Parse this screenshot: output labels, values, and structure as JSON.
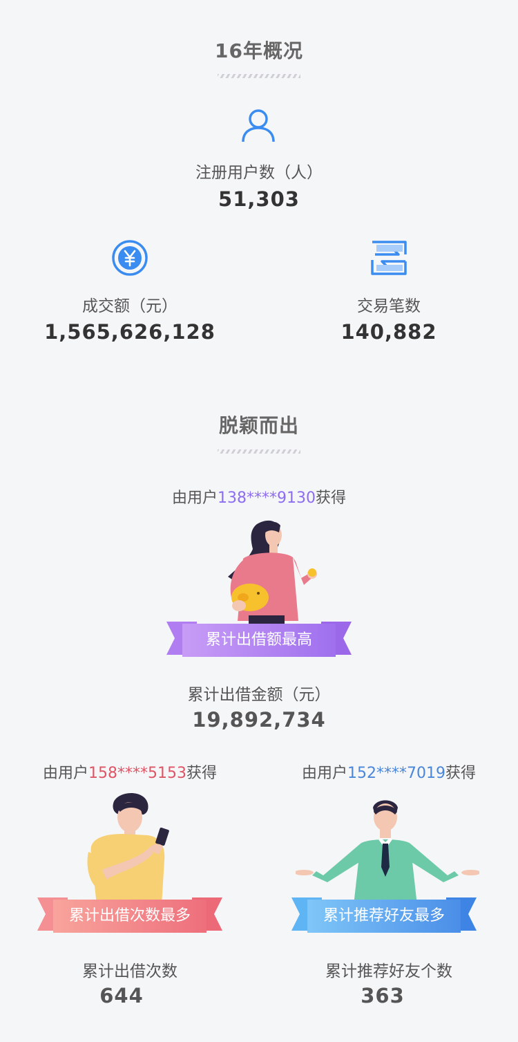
{
  "overview": {
    "title": "16年概况",
    "users": {
      "label": "注册用户数（人）",
      "value": "51,303"
    },
    "volume": {
      "label": "成交额（元）",
      "value": "1,565,626,128"
    },
    "trades": {
      "label": "交易笔数",
      "value": "140,882"
    }
  },
  "standout": {
    "title": "脱颖而出",
    "top_lender": {
      "prefix": "由用户",
      "phone": "138****9130",
      "suffix": "获得",
      "ribbon": "累计出借额最高",
      "stat_label": "累计出借金额（元）",
      "stat_value": "19,892,734",
      "accent": "#8d6cf4"
    },
    "most_lends": {
      "prefix": "由用户",
      "phone": "158****5153",
      "suffix": "获得",
      "ribbon": "累计出借次数最多",
      "stat_label": "累计出借次数",
      "stat_value": "644",
      "accent": "#de5565"
    },
    "most_referrals": {
      "prefix": "由用户",
      "phone": "152****7019",
      "suffix": "获得",
      "ribbon": "累计推荐好友最多",
      "stat_label": "累计推荐好友个数",
      "stat_value": "363",
      "accent": "#4a86d9"
    }
  }
}
